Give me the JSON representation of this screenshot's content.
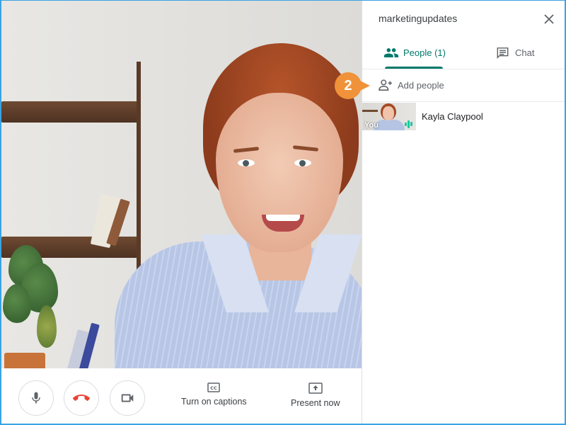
{
  "panel": {
    "meeting_name": "marketingupdates",
    "close_icon": "close-icon",
    "tabs": [
      {
        "label": "People (1)",
        "icon": "people-icon",
        "active": true
      },
      {
        "label": "Chat",
        "icon": "chat-icon",
        "active": false
      }
    ],
    "add_people": {
      "label": "Add people",
      "icon": "person-add-icon"
    },
    "participants": [
      {
        "name": "Kayla Claypool",
        "thumbnail_label": "You",
        "speaking_indicator": "audio-level-icon"
      }
    ]
  },
  "controls": {
    "microphone": {
      "icon": "microphone-icon"
    },
    "hangup": {
      "icon": "hang-up-phone-icon",
      "color": "#ea4335"
    },
    "camera": {
      "icon": "video-camera-icon"
    },
    "captions": {
      "label": "Turn on captions",
      "icon": "closed-captions-icon"
    },
    "present": {
      "label": "Present now",
      "icon": "present-screen-icon"
    }
  },
  "callout": {
    "step": "2",
    "color": "#f0923a"
  },
  "colors": {
    "accent": "#00796b",
    "frame_border": "#3aa3e3",
    "speaking": "#1ec8a0"
  }
}
